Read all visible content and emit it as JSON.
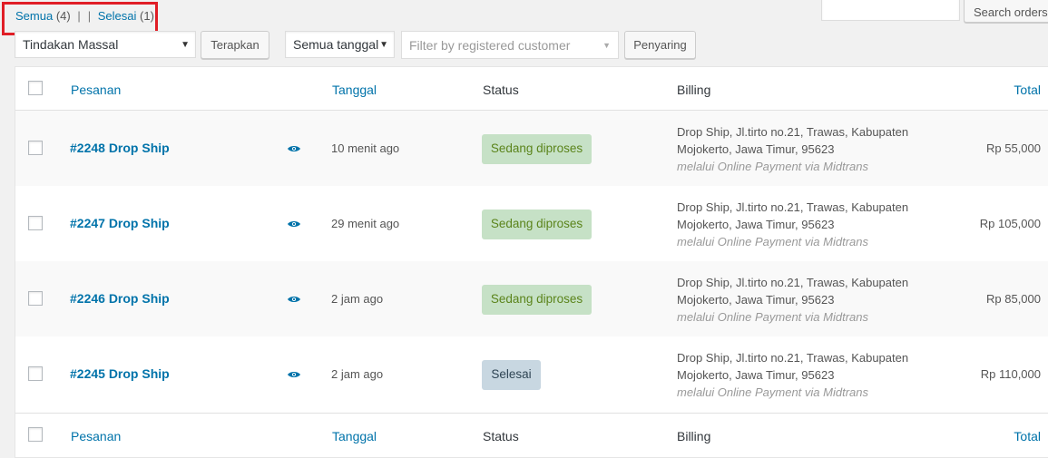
{
  "filters": {
    "all_label": "Semua",
    "all_count": "(4)",
    "completed_label": "Selesai",
    "completed_count": "(1)"
  },
  "search": {
    "placeholder": "",
    "button_label": "Search orders"
  },
  "toolbar": {
    "bulk_action": "Tindakan Massal",
    "apply_label": "Terapkan",
    "date_filter": "Semua tanggal",
    "customer_placeholder": "Filter by registered customer",
    "filter_label": "Penyaring"
  },
  "columns": {
    "order": "Pesanan",
    "date": "Tanggal",
    "status": "Status",
    "billing": "Billing",
    "total": "Total"
  },
  "orders": [
    {
      "number": "#2248 Drop Ship",
      "date": "10 menit ago",
      "status": "Sedang diproses",
      "billing_line1": "Drop Ship, Jl.tirto no.21, Trawas, Kabupaten",
      "billing_line2": "Mojokerto, Jawa Timur, 95623",
      "billing_via": "melalui Online Payment via Midtrans",
      "total": "Rp 55,000"
    },
    {
      "number": "#2247 Drop Ship",
      "date": "29 menit ago",
      "status": "Sedang diproses",
      "billing_line1": "Drop Ship, Jl.tirto no.21, Trawas, Kabupaten",
      "billing_line2": "Mojokerto, Jawa Timur, 95623",
      "billing_via": "melalui Online Payment via Midtrans",
      "total": "Rp 105,000"
    },
    {
      "number": "#2246 Drop Ship",
      "date": "2 jam ago",
      "status": "Sedang diproses",
      "billing_line1": "Drop Ship, Jl.tirto no.21, Trawas, Kabupaten",
      "billing_line2": "Mojokerto, Jawa Timur, 95623",
      "billing_via": "melalui Online Payment via Midtrans",
      "total": "Rp 85,000"
    },
    {
      "number": "#2245 Drop Ship",
      "date": "2 jam ago",
      "status": "Selesai",
      "billing_line1": "Drop Ship, Jl.tirto no.21, Trawas, Kabupaten",
      "billing_line2": "Mojokerto, Jawa Timur, 95623",
      "billing_via": "melalui Online Payment via Midtrans",
      "total": "Rp 110,000"
    }
  ],
  "colors": {
    "link": "#0073aa",
    "processing_bg": "#c6e1c6",
    "processing_text": "#5b841b",
    "completed_bg": "#c8d7e1",
    "completed_text": "#2e4453",
    "highlight_border": "#e01e26"
  },
  "icons": {
    "preview": "eye-icon",
    "dropdown": "chevron-down-icon"
  }
}
